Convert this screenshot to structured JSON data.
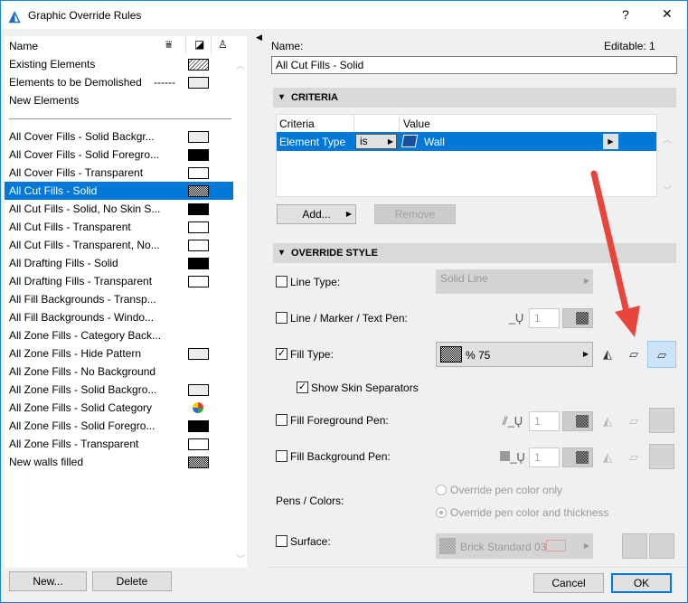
{
  "window": {
    "title": "Graphic Override Rules",
    "help": "?",
    "close": "✕"
  },
  "list": {
    "header": "Name",
    "top_items": [
      {
        "label": "Existing Elements",
        "swatch": "hatch"
      },
      {
        "label": "Elements to be Demolished",
        "swatch": "light",
        "prefix": "------"
      },
      {
        "label": "New Elements",
        "swatch": ""
      }
    ],
    "items": [
      {
        "label": "All Cover Fills - Solid Backgr...",
        "swatch": "light"
      },
      {
        "label": "All Cover Fills - Solid Foregro...",
        "swatch": "black"
      },
      {
        "label": "All Cover Fills - Transparent",
        "swatch": "white"
      },
      {
        "label": "All Cut Fills - Solid",
        "swatch": "dots",
        "selected": true
      },
      {
        "label": "All Cut Fills - Solid, No Skin S...",
        "swatch": "black"
      },
      {
        "label": "All Cut Fills - Transparent",
        "swatch": "white"
      },
      {
        "label": "All Cut Fills - Transparent, No...",
        "swatch": "white"
      },
      {
        "label": "All Drafting Fills - Solid",
        "swatch": "black"
      },
      {
        "label": "All Drafting Fills - Transparent",
        "swatch": "white"
      },
      {
        "label": "All Fill Backgrounds - Transp...",
        "swatch": ""
      },
      {
        "label": "All Fill Backgrounds - Windo...",
        "swatch": ""
      },
      {
        "label": "All Zone Fills - Category Back...",
        "swatch": ""
      },
      {
        "label": "All Zone Fills - Hide Pattern",
        "swatch": "light"
      },
      {
        "label": "All Zone Fills - No Background",
        "swatch": ""
      },
      {
        "label": "All Zone Fills - Solid Backgro...",
        "swatch": "light"
      },
      {
        "label": "All Zone Fills - Solid Category",
        "swatch": "pie"
      },
      {
        "label": "All Zone Fills - Solid Foregro...",
        "swatch": "black"
      },
      {
        "label": "All Zone Fills - Transparent",
        "swatch": "white"
      },
      {
        "label": "New walls filled",
        "swatch": "dots"
      }
    ],
    "new_button": "New...",
    "delete_button": "Delete"
  },
  "rule": {
    "name_label": "Name:",
    "editable": "Editable: 1",
    "name_value": "All Cut Fills - Solid"
  },
  "criteria": {
    "title": "CRITERIA",
    "col_criteria": "Criteria",
    "col_value": "Value",
    "row": {
      "criteria": "Element Type",
      "op": "is",
      "value": "Wall"
    },
    "add": "Add...",
    "remove": "Remove"
  },
  "override": {
    "title": "OVERRIDE STYLE",
    "line_type": {
      "label": "Line Type:",
      "checked": false,
      "value": "Solid Line"
    },
    "line_pen": {
      "label": "Line / Marker / Text Pen:",
      "checked": false,
      "value": "1"
    },
    "fill_type": {
      "label": "Fill Type:",
      "checked": true,
      "value": "%  75"
    },
    "skin_sep": {
      "label": "Show Skin Separators",
      "checked": true
    },
    "fg_pen": {
      "label": "Fill Foreground Pen:",
      "checked": false,
      "value": "1"
    },
    "bg_pen": {
      "label": "Fill Background Pen:",
      "checked": false,
      "value": "1"
    },
    "pens_colors": {
      "label": "Pens / Colors:",
      "opt1": "Override pen color only",
      "opt2": "Override pen color and thickness"
    },
    "surface": {
      "label": "Surface:",
      "checked": false,
      "value": "Brick Standard 03"
    }
  },
  "footer": {
    "cancel": "Cancel",
    "ok": "OK"
  },
  "colors": {
    "accent": "#0078d7",
    "arrow": "#e8463c"
  }
}
